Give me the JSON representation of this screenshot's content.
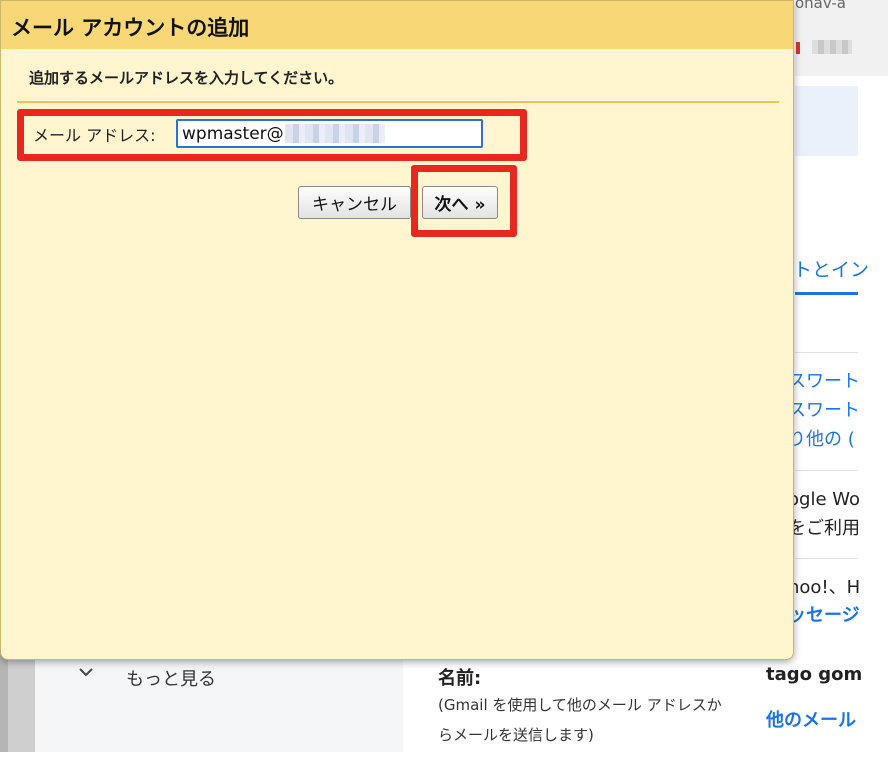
{
  "dialog": {
    "title": "メール アカウントの追加",
    "prompt": "追加するメールアドレスを入力してください。",
    "email_label": "メール アドレス:",
    "email_value": "wpmaster@           .com",
    "cancel_label": "キャンセル",
    "next_label": "次へ »"
  },
  "background": {
    "top_fragment": "onav-a",
    "tab_fragment": "トとイン",
    "lines": [
      "スワート",
      "スワート",
      "り他の (",
      "ogle Wo",
      "をご利用",
      "hoo!、H",
      "ッセージ"
    ],
    "sidebar_more": "もっと見る",
    "name_label": "名前:",
    "name_note_line1": "(Gmail を使用して他のメール アドレスか",
    "name_note_line2": "らメールを送信します)",
    "name_value": "tago gom",
    "other_mail_link": "他のメール"
  },
  "colors": {
    "dialog_bg": "#fff5cf",
    "titlebar": "#f8d777",
    "highlight": "#e8271f",
    "link": "#1a73e8",
    "input_focus": "#2f6fd6"
  },
  "icons": {
    "chevron": "chevron-down-icon"
  }
}
